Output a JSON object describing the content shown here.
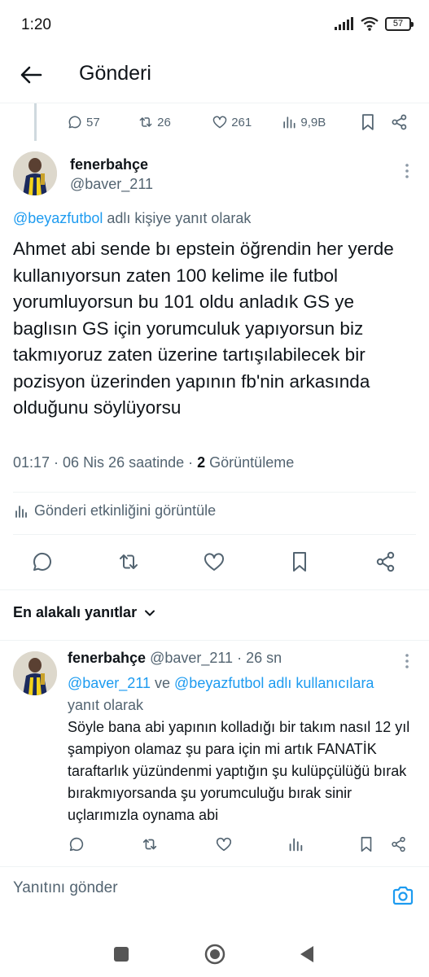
{
  "status_bar": {
    "time": "1:20",
    "battery": "57"
  },
  "header": {
    "title": "Gönderi"
  },
  "parent_stats": {
    "replies": "57",
    "reposts": "26",
    "likes": "261",
    "views": "9,9B"
  },
  "main_tweet": {
    "author_name": "fenerbahçe",
    "author_handle": "@baver_211",
    "reply_to_mention": "@beyazfutbol",
    "reply_to_suffix": " adlı kişiye yanıt olarak",
    "body": "Ahmet abi sende bı epstein öğrendin her yerde kullanıyorsun zaten 100 kelime ile futbol yorumluyorsun bu 101 oldu anladık GS ye baglısın GS için yorumculuk yapıyorsun biz takmıyoruz zaten üzerine tartışılabilecek bir pozisyon üzerinden yapının fb'nin arkasında olduğunu söylüyorsu",
    "time_date": "01:17 · 06 Nis 26 saatinde · ",
    "view_count": "2",
    "view_label": " Görüntüleme",
    "activity_label": "Gönderi etkinliğini görüntüle"
  },
  "sort_label": "En alakalı yanıtlar",
  "reply": {
    "author_name": "fenerbahçe",
    "author_handle": "@baver_211 · 26 sn",
    "mention_1": "@baver_211",
    "connector": " ve ",
    "mention_2": "@beyazfutbol",
    "suffix_1": " adlı kullanıcılara",
    "suffix_2": "yanıt olarak",
    "body": "Söyle bana abi yapının kolladığı bir takım nasıl 12 yıl şampiyon olamaz şu para için mi artık FANATİK taraftarlık yüzündenmi yaptığın şu kulüpçülüğü bırak bırakmıyorsanda şu yorumculuğu bırak sinir uçlarımızla oynama abi"
  },
  "composer": {
    "placeholder": "Yanıtını gönder"
  },
  "colors": {
    "accent": "#1d9bf0",
    "secondary_text": "#536471",
    "primary_text": "#0f1419",
    "divider": "#eff3f4"
  }
}
